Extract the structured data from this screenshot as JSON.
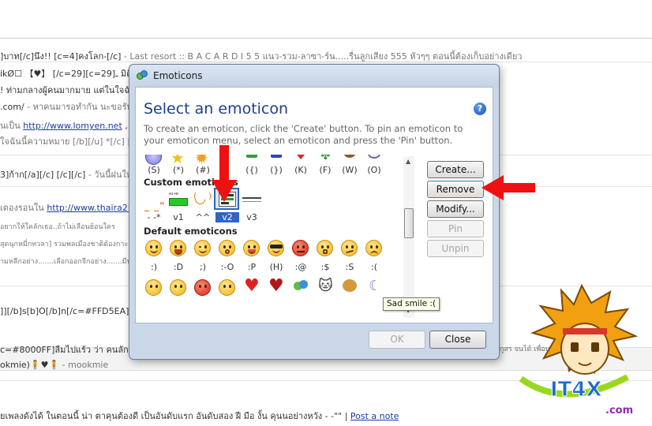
{
  "background": {
    "lines": [
      {
        "text": "]บาท[/c]นึง!!   [c=4]คงโลก-[/c]",
        "muted": " - Last resort  ::  B A C A R D I    5    5      แนว-รวม-ลาซา-ร์น.....รื่นลูกเสียง  555  หัวๆๆ          ตอนนี้ต้องเก็บอย่างเดียว"
      },
      {
        "text": "ikØ☐ 【♥】 [/c=29][c=29]ـ มิติอ...",
        "muted": ""
      },
      {
        "text": "! ท่ามกลางผู้คนมากมาย  แต่ในใจฉัน",
        "muted": ""
      },
      {
        "text": ".com/",
        "muted": " - หาคนมารอทำกัน  นะขอรับ  คิคิ  ประ"
      },
      {
        "text": "นเป็น ",
        "link": "http://www.lomyen.net",
        "after": "  ,  มิ"
      },
      {
        "text": "ใจฉันนี้ความหมาย   [/b][/u]  *[/c] |  8",
        "muted": ""
      },
      {
        "text": "3]ก้าก[/a][/c] [/c][/c]",
        "muted": " - วันนี้ฝนให้ตะ55"
      },
      {
        "text": "เตองรอนใน ",
        "link": "http://www.thaira2lov",
        "after": ""
      },
      {
        "text": "",
        "muted": "อยากให้ใคลักเธอ..ถ้าไม่เลือนย้อนใคร"
      },
      {
        "text": "",
        "muted": "สุดนุกหมี่กทวลา] รวมพลเมืองชาติต้องกาะ ปัจจุบัน"
      },
      {
        "text": "",
        "muted": "ามหลีกอย่าง.......เลือกออกจีกอย่าง.......มีนานุมที่"
      },
      {
        "text": "]][/b]s[b]O[/b]n[/c=#FFD5EA][c",
        "muted": ""
      },
      {
        "text": "c=#8000FF]ลืมไปแร้ว ว่า คนลักกั",
        "muted": ""
      },
      {
        "text": "okmie)🧍♥🧍",
        "muted": " - mookmie"
      },
      {
        "text": "ยเพลงดังได้ ในตอนนี้ น่า ตาคุนต้องดี เป็นอันดับแรก อันดับสอง ฝี มือ งั้น คุนนอย่างหวัง - -\"\" | ",
        "link": "Post a note",
        "after": ""
      }
    ],
    "band_right_text": "ปิ้ง กูสร   จนได้      เพื่อนที่เคย   ไม่ใช่ที่ได้ไกล",
    "site_logo": "IT4X",
    "site_logo_suffix": ".com"
  },
  "dialog": {
    "title": "Emoticons",
    "heading": "Select an emoticon",
    "instructions": "To create an emoticon, click the 'Create' button. To pin an emoticon to your emoticon menu, select an emoticon and press the 'Pin' button.",
    "help_icon": "question-mark-icon",
    "top_row_codes": [
      "(S)",
      "(*)",
      "(#)",
      "({)",
      "(})",
      "(K)",
      "(F)",
      "(W)",
      "(O)"
    ],
    "custom_section_label": "Custom emoticons",
    "custom_emoticons": [
      {
        "code": "- -*",
        "selected": false
      },
      {
        "code": "v1",
        "selected": false
      },
      {
        "code": "^^",
        "selected": false
      },
      {
        "code": "v2",
        "selected": true
      },
      {
        "code": "v3",
        "selected": false
      }
    ],
    "default_section_label": "Default emoticons",
    "default_codes": [
      ":)",
      ":D",
      ";)",
      ":-O",
      ":P",
      "(H)",
      ":@",
      ":$",
      ":S",
      ":("
    ],
    "buttons": {
      "create": "Create...",
      "remove": "Remove",
      "modify": "Modify...",
      "pin": "Pin",
      "unpin": "Unpin"
    },
    "footer": {
      "ok": "OK",
      "close": "Close"
    },
    "tooltip": "Sad smile :(",
    "accent_color": "#2f64c4",
    "annotation_color": "#ee1111"
  }
}
